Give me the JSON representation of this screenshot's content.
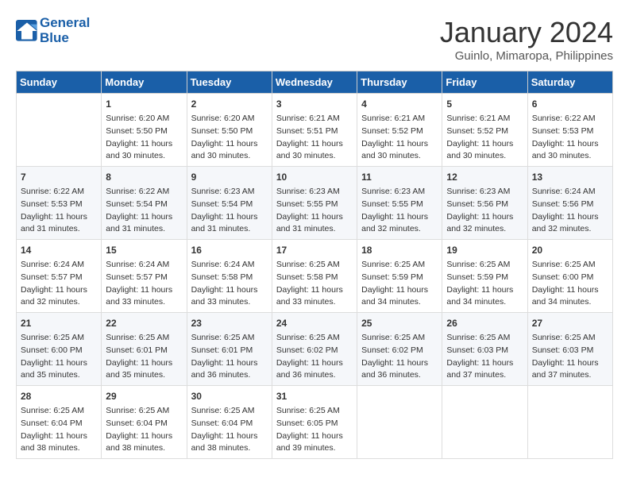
{
  "header": {
    "logo_line1": "General",
    "logo_line2": "Blue",
    "title": "January 2024",
    "subtitle": "Guinlo, Mimaropa, Philippines"
  },
  "days_of_week": [
    "Sunday",
    "Monday",
    "Tuesday",
    "Wednesday",
    "Thursday",
    "Friday",
    "Saturday"
  ],
  "weeks": [
    [
      {
        "day": "",
        "content": ""
      },
      {
        "day": "1",
        "content": "Sunrise: 6:20 AM\nSunset: 5:50 PM\nDaylight: 11 hours\nand 30 minutes."
      },
      {
        "day": "2",
        "content": "Sunrise: 6:20 AM\nSunset: 5:50 PM\nDaylight: 11 hours\nand 30 minutes."
      },
      {
        "day": "3",
        "content": "Sunrise: 6:21 AM\nSunset: 5:51 PM\nDaylight: 11 hours\nand 30 minutes."
      },
      {
        "day": "4",
        "content": "Sunrise: 6:21 AM\nSunset: 5:52 PM\nDaylight: 11 hours\nand 30 minutes."
      },
      {
        "day": "5",
        "content": "Sunrise: 6:21 AM\nSunset: 5:52 PM\nDaylight: 11 hours\nand 30 minutes."
      },
      {
        "day": "6",
        "content": "Sunrise: 6:22 AM\nSunset: 5:53 PM\nDaylight: 11 hours\nand 30 minutes."
      }
    ],
    [
      {
        "day": "7",
        "content": "Sunrise: 6:22 AM\nSunset: 5:53 PM\nDaylight: 11 hours\nand 31 minutes."
      },
      {
        "day": "8",
        "content": "Sunrise: 6:22 AM\nSunset: 5:54 PM\nDaylight: 11 hours\nand 31 minutes."
      },
      {
        "day": "9",
        "content": "Sunrise: 6:23 AM\nSunset: 5:54 PM\nDaylight: 11 hours\nand 31 minutes."
      },
      {
        "day": "10",
        "content": "Sunrise: 6:23 AM\nSunset: 5:55 PM\nDaylight: 11 hours\nand 31 minutes."
      },
      {
        "day": "11",
        "content": "Sunrise: 6:23 AM\nSunset: 5:55 PM\nDaylight: 11 hours\nand 32 minutes."
      },
      {
        "day": "12",
        "content": "Sunrise: 6:23 AM\nSunset: 5:56 PM\nDaylight: 11 hours\nand 32 minutes."
      },
      {
        "day": "13",
        "content": "Sunrise: 6:24 AM\nSunset: 5:56 PM\nDaylight: 11 hours\nand 32 minutes."
      }
    ],
    [
      {
        "day": "14",
        "content": "Sunrise: 6:24 AM\nSunset: 5:57 PM\nDaylight: 11 hours\nand 32 minutes."
      },
      {
        "day": "15",
        "content": "Sunrise: 6:24 AM\nSunset: 5:57 PM\nDaylight: 11 hours\nand 33 minutes."
      },
      {
        "day": "16",
        "content": "Sunrise: 6:24 AM\nSunset: 5:58 PM\nDaylight: 11 hours\nand 33 minutes."
      },
      {
        "day": "17",
        "content": "Sunrise: 6:25 AM\nSunset: 5:58 PM\nDaylight: 11 hours\nand 33 minutes."
      },
      {
        "day": "18",
        "content": "Sunrise: 6:25 AM\nSunset: 5:59 PM\nDaylight: 11 hours\nand 34 minutes."
      },
      {
        "day": "19",
        "content": "Sunrise: 6:25 AM\nSunset: 5:59 PM\nDaylight: 11 hours\nand 34 minutes."
      },
      {
        "day": "20",
        "content": "Sunrise: 6:25 AM\nSunset: 6:00 PM\nDaylight: 11 hours\nand 34 minutes."
      }
    ],
    [
      {
        "day": "21",
        "content": "Sunrise: 6:25 AM\nSunset: 6:00 PM\nDaylight: 11 hours\nand 35 minutes."
      },
      {
        "day": "22",
        "content": "Sunrise: 6:25 AM\nSunset: 6:01 PM\nDaylight: 11 hours\nand 35 minutes."
      },
      {
        "day": "23",
        "content": "Sunrise: 6:25 AM\nSunset: 6:01 PM\nDaylight: 11 hours\nand 36 minutes."
      },
      {
        "day": "24",
        "content": "Sunrise: 6:25 AM\nSunset: 6:02 PM\nDaylight: 11 hours\nand 36 minutes."
      },
      {
        "day": "25",
        "content": "Sunrise: 6:25 AM\nSunset: 6:02 PM\nDaylight: 11 hours\nand 36 minutes."
      },
      {
        "day": "26",
        "content": "Sunrise: 6:25 AM\nSunset: 6:03 PM\nDaylight: 11 hours\nand 37 minutes."
      },
      {
        "day": "27",
        "content": "Sunrise: 6:25 AM\nSunset: 6:03 PM\nDaylight: 11 hours\nand 37 minutes."
      }
    ],
    [
      {
        "day": "28",
        "content": "Sunrise: 6:25 AM\nSunset: 6:04 PM\nDaylight: 11 hours\nand 38 minutes."
      },
      {
        "day": "29",
        "content": "Sunrise: 6:25 AM\nSunset: 6:04 PM\nDaylight: 11 hours\nand 38 minutes."
      },
      {
        "day": "30",
        "content": "Sunrise: 6:25 AM\nSunset: 6:04 PM\nDaylight: 11 hours\nand 38 minutes."
      },
      {
        "day": "31",
        "content": "Sunrise: 6:25 AM\nSunset: 6:05 PM\nDaylight: 11 hours\nand 39 minutes."
      },
      {
        "day": "",
        "content": ""
      },
      {
        "day": "",
        "content": ""
      },
      {
        "day": "",
        "content": ""
      }
    ]
  ]
}
